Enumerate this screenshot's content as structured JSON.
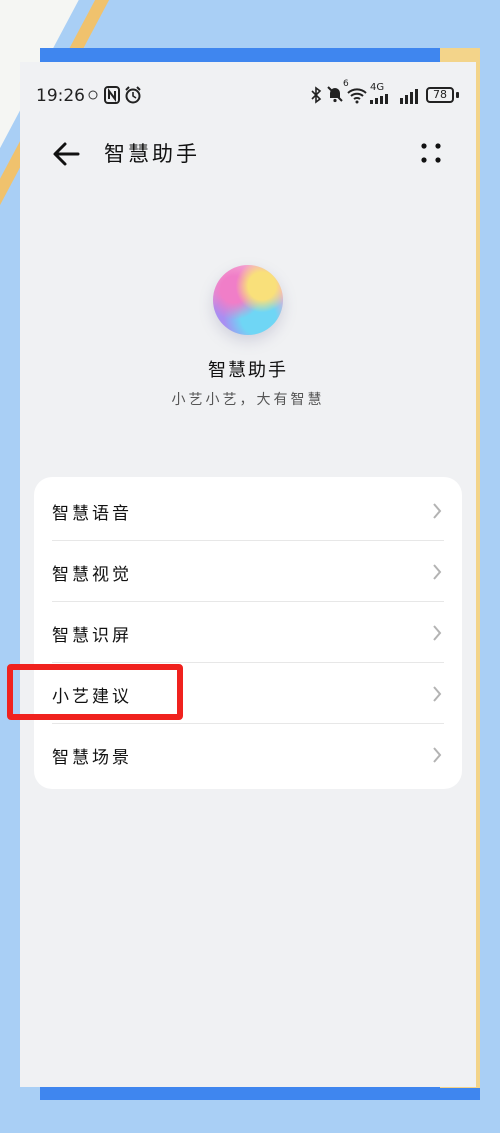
{
  "status_bar": {
    "time": "19:26",
    "icons": [
      "nfc-icon",
      "alarm-icon",
      "bluetooth-icon",
      "mute-icon",
      "wifi-6-icon",
      "4g-icon",
      "signal-icon"
    ],
    "wifi_label": "6",
    "network_label": "4G",
    "battery": "78"
  },
  "header": {
    "title": "智慧助手",
    "back_icon": "back-arrow-icon",
    "more_icon": "more-dots-icon"
  },
  "app": {
    "name": "智慧助手",
    "slogan": "小艺小艺，大有智慧"
  },
  "menu": {
    "items": [
      {
        "label": "智慧语音"
      },
      {
        "label": "智慧视觉"
      },
      {
        "label": "智慧识屏"
      },
      {
        "label": "小艺建议"
      },
      {
        "label": "智慧场景"
      }
    ]
  },
  "annotation": {
    "highlight_color": "#f0221e",
    "highlighted_item": "智慧场景"
  },
  "colors": {
    "page_background": "#a9cff5",
    "screen_background": "#f0f1f3",
    "card_background": "#ffffff"
  }
}
